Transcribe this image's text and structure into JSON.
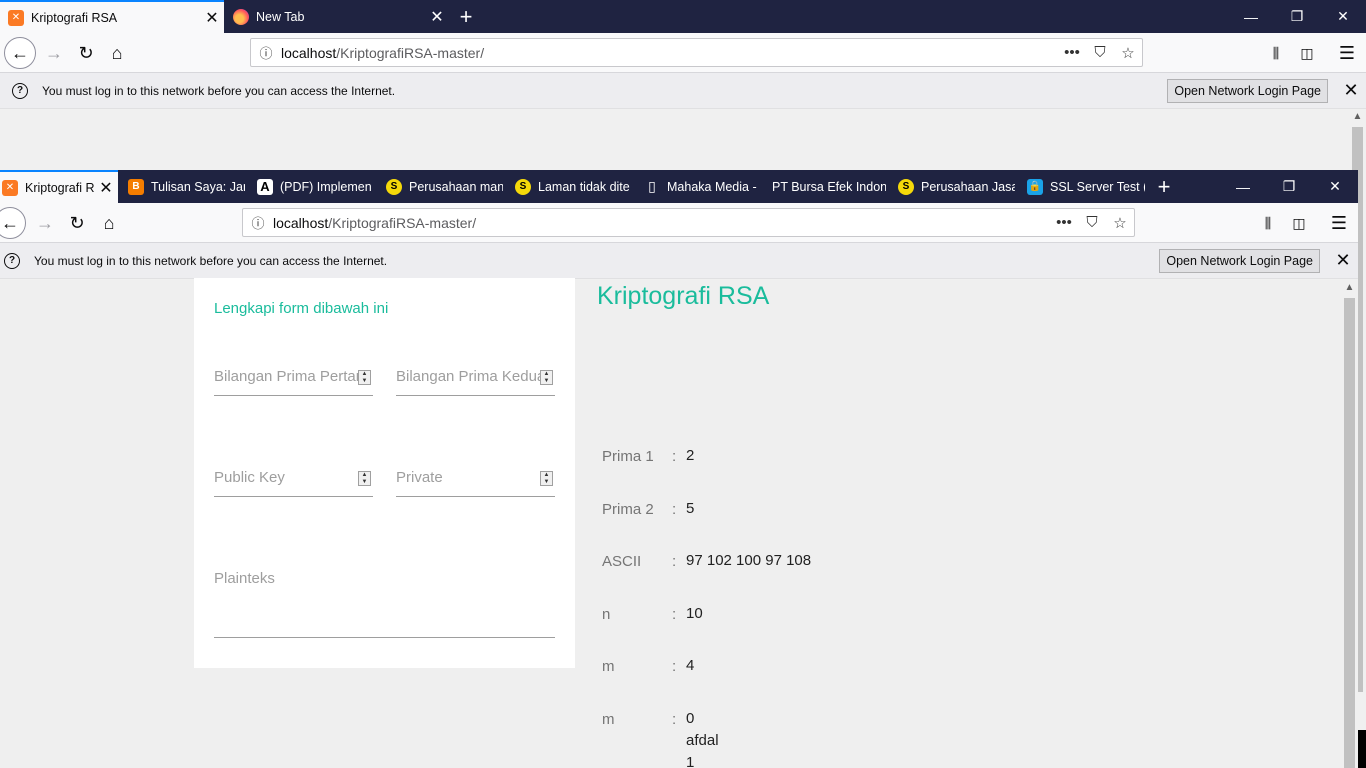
{
  "outer": {
    "tabs": [
      {
        "label": "Kriptografi RSA",
        "active": true
      },
      {
        "label": "New Tab",
        "active": false
      }
    ],
    "url": {
      "host": "localhost",
      "path": "/KriptografiRSA-master/"
    },
    "notification": {
      "text": "You must log in to this network before you can access the Internet.",
      "button": "Open Network Login Page"
    }
  },
  "inner": {
    "tabs": [
      {
        "label": "Kriptografi RSA",
        "active": true
      },
      {
        "label": "Tulisan Saya: Jan"
      },
      {
        "label": "(PDF) Implemen"
      },
      {
        "label": "Perusahaan man"
      },
      {
        "label": "Laman tidak dite"
      },
      {
        "label": "Mahaka Media -"
      },
      {
        "label": "PT Bursa Efek Indone"
      },
      {
        "label": "Perusahaan Jasa"
      },
      {
        "label": "SSL Server Test (I"
      }
    ],
    "url": {
      "host": "localhost",
      "path": "/KriptografiRSA-master/"
    },
    "notification": {
      "text": "You must log in to this network before you can access the Internet.",
      "button": "Open Network Login Page"
    }
  },
  "form": {
    "title": "Lengkapi form dibawah ini",
    "prima1_placeholder": "Bilangan Prima Pertama",
    "prima2_placeholder": "Bilangan Prima Kedua",
    "public_key_placeholder": "Public Key",
    "private_placeholder": "Private",
    "plainteks_placeholder": "Plainteks"
  },
  "result": {
    "title": "Kriptografi RSA",
    "rows": [
      {
        "label": "Prima 1",
        "value": "2"
      },
      {
        "label": "Prima 2",
        "value": "5"
      },
      {
        "label": "ASCII",
        "value": "97 102 100 97 108"
      },
      {
        "label": "n",
        "value": "10"
      },
      {
        "label": "m",
        "value": "4"
      },
      {
        "label": "m",
        "value": "0",
        "extra": [
          "afdal",
          "1"
        ]
      }
    ]
  },
  "colors": {
    "accent": "#1abc9c",
    "titlebar": "#1f2341",
    "active_tab_border": "#0a84ff"
  }
}
